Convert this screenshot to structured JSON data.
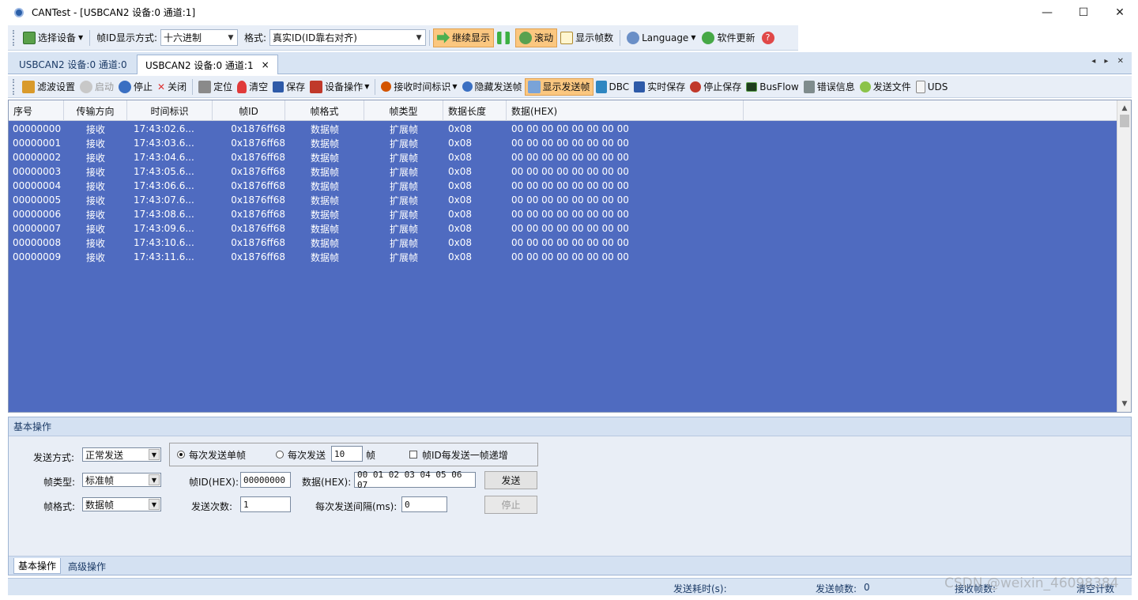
{
  "window": {
    "title": "CANTest  - [USBCAN2 设备:0 通道:1]",
    "min_icon": "—",
    "max_icon": "☐",
    "close_icon": "✕"
  },
  "toolbar1": {
    "select_device": "选择设备",
    "frame_id_display_label": "帧ID显示方式:",
    "frame_id_display_value": "十六进制",
    "format_label": "格式:",
    "format_value": "真实ID(ID靠右对齐)",
    "continue_display": "继续显示",
    "scroll": "滚动",
    "show_frame_count": "显示帧数",
    "language": "Language",
    "software_update": "软件更新"
  },
  "tabs": [
    {
      "label": "USBCAN2 设备:0 通道:0"
    },
    {
      "label": "USBCAN2 设备:0 通道:1",
      "close": "×"
    }
  ],
  "tab_nav": "◂ ▸ ✕",
  "toolbar2": {
    "filter": "滤波设置",
    "start": "启动",
    "stop": "停止",
    "close": "关闭",
    "locate": "定位",
    "clear": "清空",
    "save": "保存",
    "device_ops": "设备操作",
    "recv_time": "接收时间标识",
    "hide_send": "隐藏发送帧",
    "show_send": "显示发送帧",
    "dbc": "DBC",
    "realtime_save": "实时保存",
    "stop_save": "停止保存",
    "busflow": "BusFlow",
    "error_info": "错误信息",
    "send_file": "发送文件",
    "uds": "UDS"
  },
  "grid": {
    "headers": [
      "序号",
      "传输方向",
      "时间标识",
      "帧ID",
      "帧格式",
      "帧类型",
      "数据长度",
      "数据(HEX)"
    ],
    "rows": [
      [
        "00000000",
        "接收",
        "17:43:02.6...",
        "0x1876ff68",
        "数据帧",
        "扩展帧",
        "0x08",
        "00 00 00 00 00 00 00 00"
      ],
      [
        "00000001",
        "接收",
        "17:43:03.6...",
        "0x1876ff68",
        "数据帧",
        "扩展帧",
        "0x08",
        "00 00 00 00 00 00 00 00"
      ],
      [
        "00000002",
        "接收",
        "17:43:04.6...",
        "0x1876ff68",
        "数据帧",
        "扩展帧",
        "0x08",
        "00 00 00 00 00 00 00 00"
      ],
      [
        "00000003",
        "接收",
        "17:43:05.6...",
        "0x1876ff68",
        "数据帧",
        "扩展帧",
        "0x08",
        "00 00 00 00 00 00 00 00"
      ],
      [
        "00000004",
        "接收",
        "17:43:06.6...",
        "0x1876ff68",
        "数据帧",
        "扩展帧",
        "0x08",
        "00 00 00 00 00 00 00 00"
      ],
      [
        "00000005",
        "接收",
        "17:43:07.6...",
        "0x1876ff68",
        "数据帧",
        "扩展帧",
        "0x08",
        "00 00 00 00 00 00 00 00"
      ],
      [
        "00000006",
        "接收",
        "17:43:08.6...",
        "0x1876ff68",
        "数据帧",
        "扩展帧",
        "0x08",
        "00 00 00 00 00 00 00 00"
      ],
      [
        "00000007",
        "接收",
        "17:43:09.6...",
        "0x1876ff68",
        "数据帧",
        "扩展帧",
        "0x08",
        "00 00 00 00 00 00 00 00"
      ],
      [
        "00000008",
        "接收",
        "17:43:10.6...",
        "0x1876ff68",
        "数据帧",
        "扩展帧",
        "0x08",
        "00 00 00 00 00 00 00 00"
      ],
      [
        "00000009",
        "接收",
        "17:43:11.6...",
        "0x1876ff68",
        "数据帧",
        "扩展帧",
        "0x08",
        "00 00 00 00 00 00 00 00"
      ]
    ]
  },
  "panel": {
    "title": "基本操作",
    "send_mode_label": "发送方式:",
    "send_mode_value": "正常发送",
    "radio_single": "每次发送单帧",
    "radio_multi": "每次发送",
    "multi_count": "10",
    "frames_unit": "帧",
    "increment_label": "帧ID每发送一帧递增",
    "frame_type_label": "帧类型:",
    "frame_type_value": "标准帧",
    "frame_id_label": "帧ID(HEX):",
    "frame_id_value": "00000000",
    "data_label": "数据(HEX):",
    "data_value": "00 01 02 03 04 05 06 07",
    "send_button": "发送",
    "frame_format_label": "帧格式:",
    "frame_format_value": "数据帧",
    "send_count_label": "发送次数:",
    "send_count_value": "1",
    "interval_label": "每次发送间隔(ms):",
    "interval_value": "0",
    "stop_button": "停止",
    "tabs": [
      "基本操作",
      "高级操作"
    ]
  },
  "status": {
    "send_time_label": "发送耗时(s):",
    "send_frames_label": "发送帧数:",
    "send_frames_value": "0",
    "recv_frames_label": "接收帧数:",
    "clear_count": "清空计数"
  },
  "watermark": "CSDN @weixin_46098384",
  "colors": {
    "grid_bg": "#4f6bc0",
    "highlight": "#fbc780",
    "toolbar_bg": "#e8eef7"
  }
}
